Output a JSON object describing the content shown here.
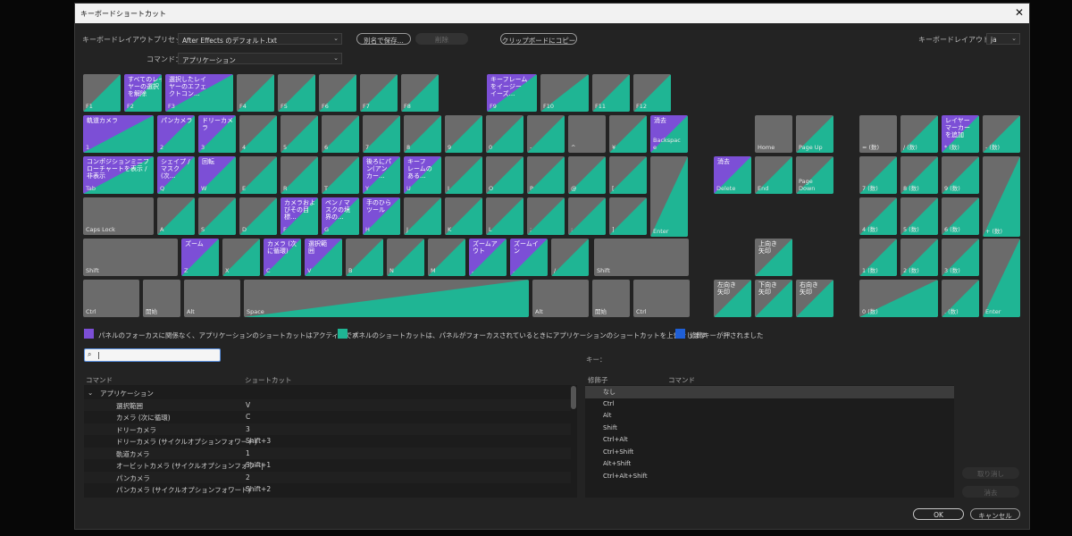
{
  "window": {
    "title": "キーボードショートカット"
  },
  "controls": {
    "preset_label": "キーボードレイアウトプリセット：",
    "preset_value": "After Effects のデフォルト.txt",
    "command_label": "コマンド：",
    "command_value": "アプリケーション",
    "save_as": "別名で保存...",
    "delete": "削除",
    "copy_clipboard": "クリップボードにコピー",
    "layout_label": "キーボードレイアウト：",
    "layout_value": "ja"
  },
  "colors": {
    "app_shortcut": "#7c4fd6",
    "panel_shortcut": "#1fb594",
    "modifier": "#1f5fd6",
    "unassigned": "#6b6b6b"
  },
  "legend": {
    "app": "パネルのフォーカスに関係なく、アプリケーションのショートカットはアクティブです",
    "panel": "パネルのショートカットは、パネルがフォーカスされているときにアプリケーションのショートカットを上書きします",
    "modifier": "修飾キーが押されました"
  },
  "search": {
    "value": "|"
  },
  "list": {
    "col_command": "コマンド",
    "col_shortcut": "ショートカット",
    "group": "アプリケーション",
    "rows": [
      {
        "command": "選択範囲",
        "shortcut": "V"
      },
      {
        "command": "カメラ (次に循環)",
        "shortcut": "C"
      },
      {
        "command": "ドリーカメラ",
        "shortcut": "3"
      },
      {
        "command": "ドリーカメラ (サイクルオプションフォワード)",
        "shortcut": "Shift+3"
      },
      {
        "command": "軌道カメラ",
        "shortcut": "1"
      },
      {
        "command": "オービットカメラ (サイクルオプションフォワー|",
        "shortcut": "Shift+1"
      },
      {
        "command": "パンカメラ",
        "shortcut": "2"
      },
      {
        "command": "パンカメラ (サイクルオプションフォワード)",
        "shortcut": "Shift+2"
      }
    ]
  },
  "key_section": {
    "title": "キー：",
    "col_modifier": "修飾子",
    "col_command": "コマンド",
    "modifiers": [
      "なし",
      "Ctrl",
      "Alt",
      "Shift",
      "Ctrl+Alt",
      "Ctrl+Shift",
      "Alt+Shift",
      "Ctrl+Alt+Shift"
    ]
  },
  "buttons": {
    "undo": "取り消し",
    "clear": "消去",
    "ok": "OK",
    "cancel": "キャンセル"
  },
  "keyboard": {
    "F1": {
      "label": "F1",
      "cmd": ""
    },
    "F2": {
      "label": "F2",
      "cmd": "すべてのレイ\nヤーの選択\nを解除"
    },
    "F3": {
      "label": "F3",
      "cmd": "選択したレイ\nヤーのエフェ\nクトコン..."
    },
    "F4": {
      "label": "F4",
      "cmd": ""
    },
    "F5": {
      "label": "F5",
      "cmd": ""
    },
    "F6": {
      "label": "F6",
      "cmd": ""
    },
    "F7": {
      "label": "F7",
      "cmd": ""
    },
    "F8": {
      "label": "F8",
      "cmd": ""
    },
    "F9": {
      "label": "F9",
      "cmd": "キーフレーム\nをイージー\nイーズ..."
    },
    "F10": {
      "label": "F10",
      "cmd": ""
    },
    "F11": {
      "label": "F11",
      "cmd": ""
    },
    "F12": {
      "label": "F12",
      "cmd": ""
    },
    "K1": {
      "label": "1",
      "cmd": "軌道カメラ"
    },
    "K2": {
      "label": "2",
      "cmd": "パンカメラ"
    },
    "K3": {
      "label": "3",
      "cmd": "ドリーカメ\nラ"
    },
    "K4": {
      "label": "4",
      "cmd": ""
    },
    "K5": {
      "label": "5",
      "cmd": ""
    },
    "K6": {
      "label": "6",
      "cmd": ""
    },
    "K7": {
      "label": "7",
      "cmd": ""
    },
    "K8": {
      "label": "8",
      "cmd": ""
    },
    "K9": {
      "label": "9",
      "cmd": ""
    },
    "K0": {
      "label": "0",
      "cmd": ""
    },
    "Kminus": {
      "label": "-",
      "cmd": ""
    },
    "Kcaret": {
      "label": "^",
      "cmd": ""
    },
    "Kyen": {
      "label": "¥",
      "cmd": ""
    },
    "Kbs": {
      "label": "Backspac\ne",
      "cmd": "消去"
    },
    "Tab": {
      "label": "Tab",
      "cmd": "コンポジションミニフ\nローチャートを表示 /\n非表示"
    },
    "Q": {
      "label": "Q",
      "cmd": "シェイプ /\nマスク\n(次..."
    },
    "W": {
      "label": "W",
      "cmd": "回転"
    },
    "E": {
      "label": "E",
      "cmd": ""
    },
    "R": {
      "label": "R",
      "cmd": ""
    },
    "T": {
      "label": "T",
      "cmd": ""
    },
    "Y": {
      "label": "Y",
      "cmd": "後ろにパ\nン(アン\nカー..."
    },
    "U": {
      "label": "U",
      "cmd": "キーフ\nレームの\nある..."
    },
    "I": {
      "label": "I",
      "cmd": ""
    },
    "O": {
      "label": "O",
      "cmd": ""
    },
    "P": {
      "label": "P",
      "cmd": ""
    },
    "At": {
      "label": "@",
      "cmd": ""
    },
    "Lbr": {
      "label": "[",
      "cmd": ""
    },
    "Enter": {
      "label": "Enter",
      "cmd": ""
    },
    "Caps": {
      "label": "Caps Lock",
      "cmd": ""
    },
    "A": {
      "label": "A",
      "cmd": ""
    },
    "S": {
      "label": "S",
      "cmd": ""
    },
    "D": {
      "label": "D",
      "cmd": ""
    },
    "F": {
      "label": "F",
      "cmd": "カメラおよ\nびその目\n標..."
    },
    "G": {
      "label": "G",
      "cmd": "ペン / マ\nスクの境\n界の..."
    },
    "H": {
      "label": "H",
      "cmd": "手のひら\nツール"
    },
    "J": {
      "label": "J",
      "cmd": ""
    },
    "K": {
      "label": "K",
      "cmd": ""
    },
    "L": {
      "label": "L",
      "cmd": ""
    },
    "Semi": {
      "label": ";",
      "cmd": ""
    },
    "Colon": {
      "label": ":",
      "cmd": ""
    },
    "Rbr": {
      "label": "]",
      "cmd": ""
    },
    "ShiftL": {
      "label": "Shift",
      "cmd": ""
    },
    "Z": {
      "label": "Z",
      "cmd": "ズーム"
    },
    "X": {
      "label": "X",
      "cmd": ""
    },
    "C": {
      "label": "C",
      "cmd": "カメラ (次\nに循環)"
    },
    "V": {
      "label": "V",
      "cmd": "選択範\n囲"
    },
    "B": {
      "label": "B",
      "cmd": ""
    },
    "N": {
      "label": "N",
      "cmd": ""
    },
    "M": {
      "label": "M",
      "cmd": ""
    },
    "Comma": {
      "label": ",",
      "cmd": "ズームア\nウト"
    },
    "Period": {
      "label": ".",
      "cmd": "ズームイ\nン"
    },
    "Slash": {
      "label": "/",
      "cmd": ""
    },
    "ShiftR": {
      "label": "Shift",
      "cmd": ""
    },
    "CtrlL": {
      "label": "Ctrl",
      "cmd": ""
    },
    "MuhenL": {
      "label": "開始",
      "cmd": ""
    },
    "AltL": {
      "label": "Alt",
      "cmd": ""
    },
    "Space": {
      "label": "Space",
      "cmd": ""
    },
    "AltR": {
      "label": "Alt",
      "cmd": ""
    },
    "MuhenR": {
      "label": "開始",
      "cmd": ""
    },
    "CtrlR": {
      "label": "Ctrl",
      "cmd": ""
    },
    "Home": {
      "label": "Home",
      "cmd": ""
    },
    "PgUp": {
      "label": "Page Up",
      "cmd": ""
    },
    "Del": {
      "label": "Delete",
      "cmd": "消去"
    },
    "End": {
      "label": "End",
      "cmd": ""
    },
    "PgDn": {
      "label": "Page\nDown",
      "cmd": ""
    },
    "Up": {
      "label": "",
      "cmd": "上向き\n矢印"
    },
    "Left": {
      "label": "",
      "cmd": "左向き\n矢印"
    },
    "Down": {
      "label": "",
      "cmd": "下向き\n矢印"
    },
    "Right": {
      "label": "",
      "cmd": "右向き\n矢印"
    },
    "NEq": {
      "label": "= (数)",
      "cmd": ""
    },
    "NSlash": {
      "label": "/ (数)",
      "cmd": ""
    },
    "NStar": {
      "label": "* (数)",
      "cmd": "レイヤー\nマーカー\nを追加"
    },
    "NMinus": {
      "label": "- (数)",
      "cmd": ""
    },
    "N7": {
      "label": "7 (数)",
      "cmd": ""
    },
    "N8": {
      "label": "8 (数)",
      "cmd": ""
    },
    "N9": {
      "label": "9 (数)",
      "cmd": ""
    },
    "NPlus": {
      "label": "+ (数)",
      "cmd": ""
    },
    "N4": {
      "label": "4 (数)",
      "cmd": ""
    },
    "N5": {
      "label": "5 (数)",
      "cmd": ""
    },
    "N6": {
      "label": "6 (数)",
      "cmd": ""
    },
    "N1": {
      "label": "1 (数)",
      "cmd": ""
    },
    "N2": {
      "label": "2 (数)",
      "cmd": ""
    },
    "N3": {
      "label": "3 (数)",
      "cmd": ""
    },
    "NEnter": {
      "label": "Enter",
      "cmd": ""
    },
    "N0": {
      "label": "0 (数)",
      "cmd": ""
    },
    "NDot": {
      "label": ". (数)",
      "cmd": ""
    }
  }
}
